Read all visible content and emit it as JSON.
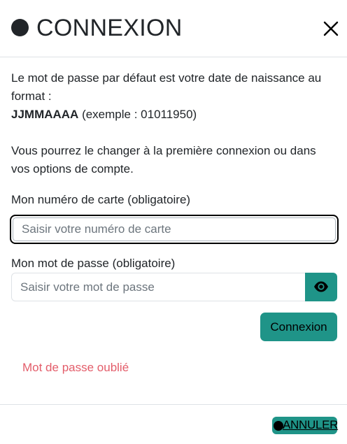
{
  "modal": {
    "title": "CONNEXION",
    "close_icon": "close-icon"
  },
  "info": {
    "line1": "Le mot de passe par défaut est votre date de naissance au",
    "line2": "format :",
    "format_bold": "JJMMAAAA",
    "format_example": " (exemple : 01011950)",
    "line4": "Vous pourrez le changer à la première connexion ou dans",
    "line5": "vos options de compte."
  },
  "card_field": {
    "label": "Mon numéro de carte (obligatoire)",
    "placeholder": "Saisir votre numéro de carte",
    "value": ""
  },
  "password_field": {
    "label": "Mon mot de passe (obligatoire)",
    "placeholder": "Saisir votre mot de passe",
    "value": "",
    "toggle_icon": "eye-icon"
  },
  "buttons": {
    "login_label": "Connexion",
    "forgot_label": "Mot de passe oublié",
    "cancel_label": "ANNULER"
  },
  "colors": {
    "accent": "#1f9488",
    "danger_link": "#e35d6a",
    "text": "#212529"
  }
}
